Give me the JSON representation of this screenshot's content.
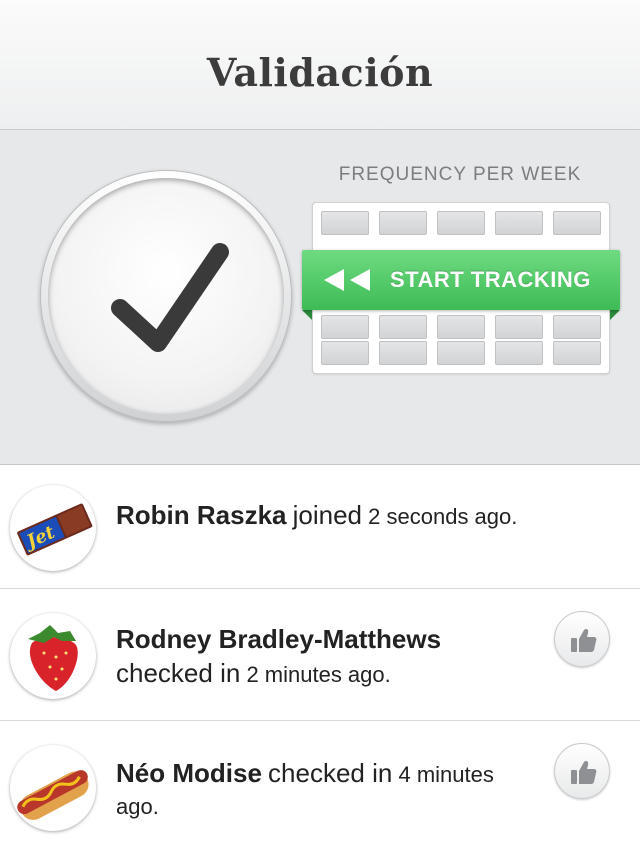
{
  "header": {
    "title": "Validación"
  },
  "tracker": {
    "frequency_title": "FREQUENCY PER WEEK",
    "start_label": "START TRACKING",
    "check_icon": "checkmark-icon",
    "arrows_icon": "rewind-icon"
  },
  "feed": [
    {
      "name": "Robin Raszka",
      "verb": "joined",
      "time": "2 seconds ago.",
      "avatar": "chocolate-bar",
      "likeable": false
    },
    {
      "name": "Rodney Bradley-Matthews",
      "verb": "checked in",
      "time": "2 minutes ago.",
      "avatar": "strawberry",
      "likeable": true
    },
    {
      "name": "Néo Modise",
      "verb": "checked in",
      "time": "4 minutes ago.",
      "avatar": "hot-dog",
      "likeable": true
    }
  ],
  "colors": {
    "accent_green": "#3dbb55",
    "title_text": "#3c3c3c"
  }
}
